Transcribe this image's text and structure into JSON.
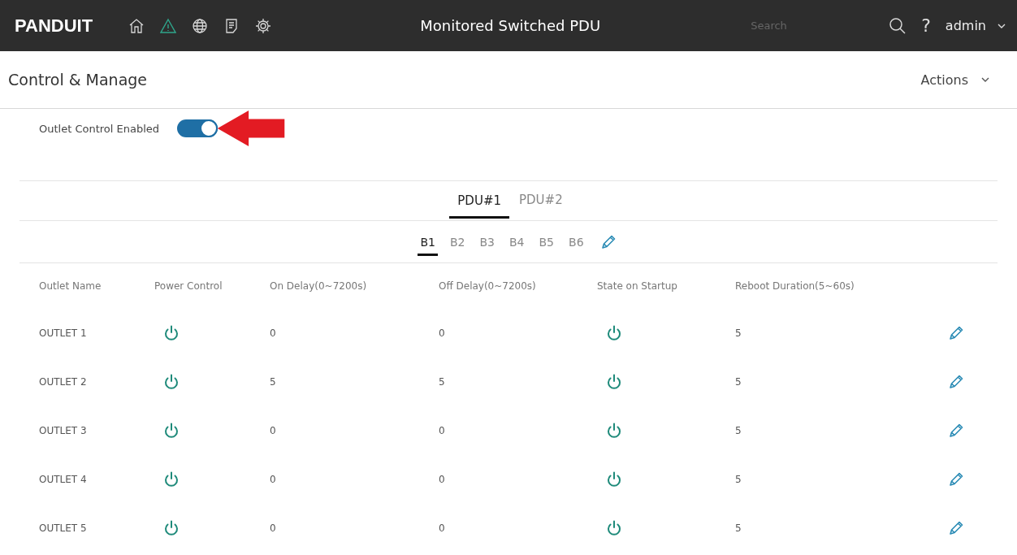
{
  "header": {
    "logo": "PANDUIT",
    "nav": [
      {
        "kind": "home",
        "selected": false
      },
      {
        "kind": "alert",
        "selected": true
      },
      {
        "kind": "globe",
        "selected": false
      },
      {
        "kind": "log",
        "selected": false
      },
      {
        "kind": "settings",
        "selected": false
      }
    ],
    "title": "Monitored Switched PDU",
    "search": {
      "placeholder": "Search"
    },
    "help": "?",
    "user": "admin"
  },
  "page": {
    "title": "Control & Manage",
    "actions": "Actions"
  },
  "outlet_control": {
    "label": "Outlet Control Enabled",
    "on": true
  },
  "pdu_tabs": [
    {
      "label": "PDU#1",
      "selected": true
    },
    {
      "label": "PDU#2",
      "selected": false
    }
  ],
  "bank_tabs": [
    {
      "label": "B1",
      "selected": true
    },
    {
      "label": "B2",
      "selected": false
    },
    {
      "label": "B3",
      "selected": false
    },
    {
      "label": "B4",
      "selected": false
    },
    {
      "label": "B5",
      "selected": false
    },
    {
      "label": "B6",
      "selected": false
    }
  ],
  "table": {
    "columns": [
      "Outlet Name",
      "Power Control",
      "On Delay(0~7200s)",
      "Off Delay(0~7200s)",
      "State on Startup",
      "Reboot Duration(5~60s)"
    ],
    "rows": [
      {
        "name": "OUTLET 1",
        "power_on": true,
        "on_delay": "0",
        "off_delay": "0",
        "startup_on": true,
        "reboot": "5"
      },
      {
        "name": "OUTLET 2",
        "power_on": true,
        "on_delay": "5",
        "off_delay": "5",
        "startup_on": true,
        "reboot": "5"
      },
      {
        "name": "OUTLET 3",
        "power_on": true,
        "on_delay": "0",
        "off_delay": "0",
        "startup_on": true,
        "reboot": "5"
      },
      {
        "name": "OUTLET 4",
        "power_on": true,
        "on_delay": "0",
        "off_delay": "0",
        "startup_on": true,
        "reboot": "5"
      },
      {
        "name": "OUTLET 5",
        "power_on": true,
        "on_delay": "0",
        "off_delay": "0",
        "startup_on": true,
        "reboot": "5"
      }
    ]
  }
}
